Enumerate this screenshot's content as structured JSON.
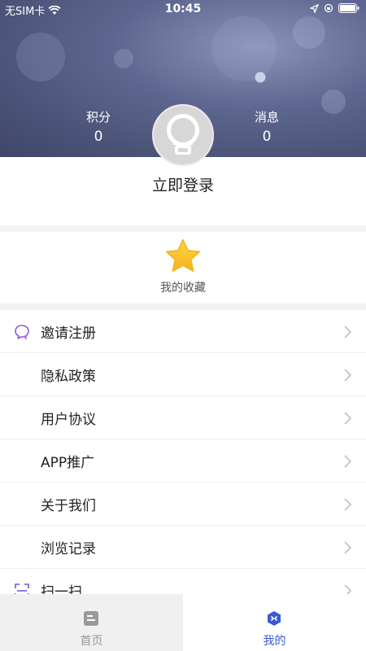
{
  "status_bar": {
    "carrier": "无SIM卡",
    "time": "10:45"
  },
  "profile": {
    "points_label": "积分",
    "points_value": "0",
    "messages_label": "消息",
    "messages_value": "0",
    "login_text": "立即登录"
  },
  "favorites": {
    "label": "我的收藏"
  },
  "menu": {
    "items": [
      {
        "label": "邀请注册",
        "icon": "chat-bubble-icon"
      },
      {
        "label": "隐私政策"
      },
      {
        "label": "用户协议"
      },
      {
        "label": "APP推广"
      },
      {
        "label": "关于我们"
      },
      {
        "label": "浏览记录"
      },
      {
        "label": "扫一扫",
        "icon": "scan-icon"
      }
    ]
  },
  "tabbar": {
    "tabs": [
      {
        "label": "首页",
        "icon": "home-icon",
        "active": false
      },
      {
        "label": "我的",
        "icon": "mine-icon",
        "active": true
      }
    ],
    "active_color": "#3b5ad6",
    "inactive_color": "#999999"
  }
}
